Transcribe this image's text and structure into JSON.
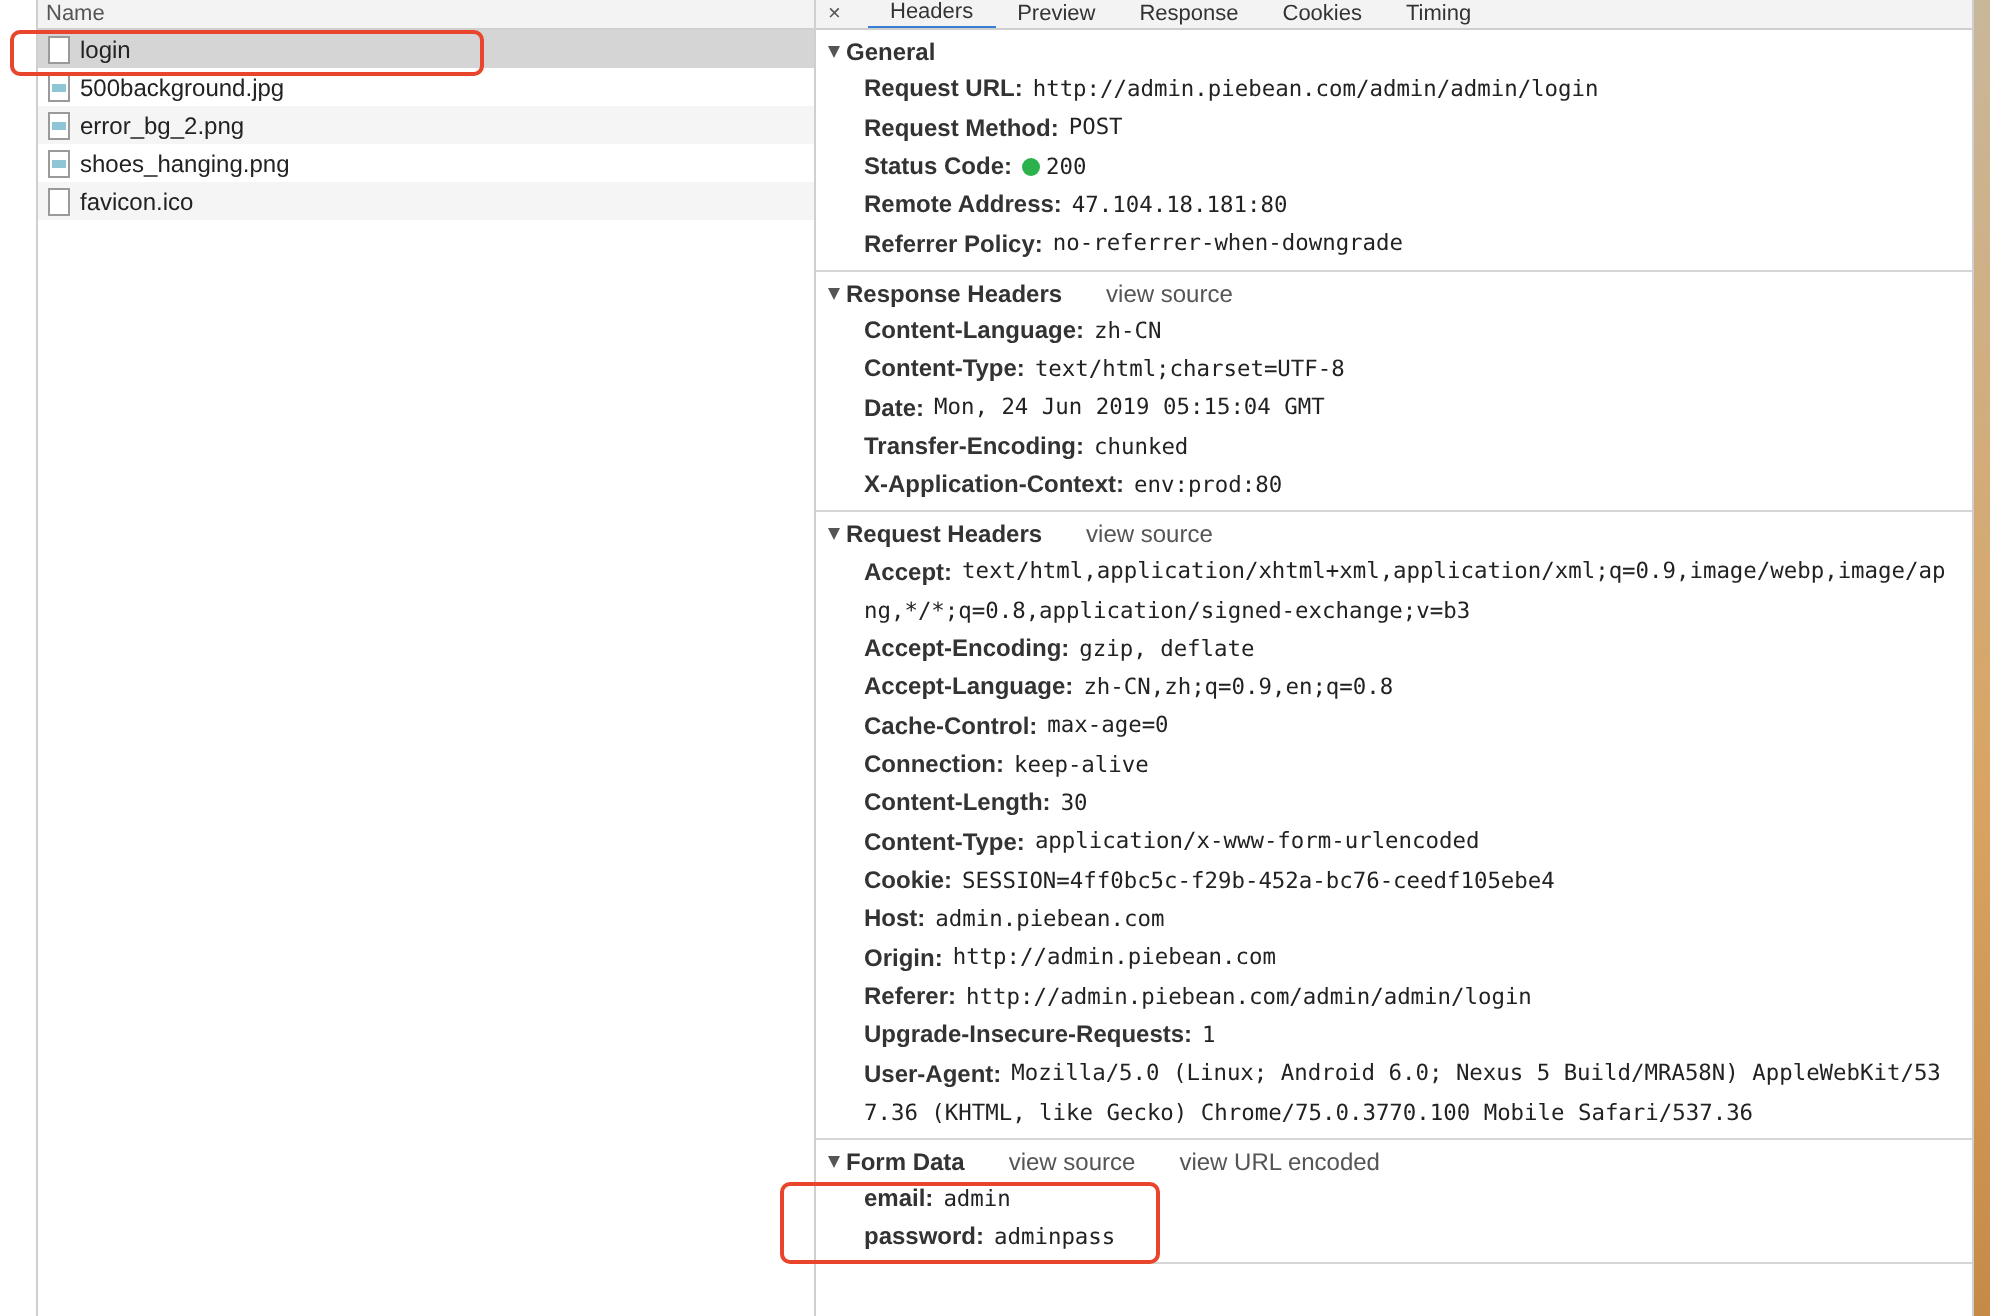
{
  "requests": {
    "column": "Name",
    "items": [
      {
        "name": "login",
        "kind": "document",
        "selected": true,
        "highlighted": true
      },
      {
        "name": "500background.jpg",
        "kind": "image",
        "selected": false,
        "highlighted": false
      },
      {
        "name": "error_bg_2.png",
        "kind": "image",
        "selected": false,
        "highlighted": false
      },
      {
        "name": "shoes_hanging.png",
        "kind": "image",
        "selected": false,
        "highlighted": false
      },
      {
        "name": "favicon.ico",
        "kind": "document",
        "selected": false,
        "highlighted": false
      }
    ]
  },
  "close": "×",
  "tabs": [
    {
      "label": "Headers",
      "selected": true
    },
    {
      "label": "Preview",
      "selected": false
    },
    {
      "label": "Response",
      "selected": false
    },
    {
      "label": "Cookies",
      "selected": false
    },
    {
      "label": "Timing",
      "selected": false
    }
  ],
  "sections": [
    {
      "title": "General",
      "expanded": true,
      "rows": [
        {
          "name": "Request URL:",
          "value": "http://admin.piebean.com/admin/admin/login"
        },
        {
          "name": "Request Method:",
          "value": "POST"
        },
        {
          "name": "Status Code:",
          "value": "200",
          "color": "#2bb24c"
        },
        {
          "name": "Remote Address:",
          "value": "47.104.18.181:80"
        },
        {
          "name": "Referrer Policy:",
          "value": "no-referrer-when-downgrade"
        }
      ]
    },
    {
      "title": "Response Headers",
      "expanded": true,
      "links": [
        "view source"
      ],
      "rows": [
        {
          "name": "Content-Language:",
          "value": "zh-CN"
        },
        {
          "name": "Content-Type:",
          "value": "text/html;charset=UTF-8"
        },
        {
          "name": "Date:",
          "value": "Mon, 24 Jun 2019 05:15:04 GMT"
        },
        {
          "name": "Transfer-Encoding:",
          "value": "chunked"
        },
        {
          "name": "X-Application-Context:",
          "value": "env:prod:80"
        }
      ]
    },
    {
      "title": "Request Headers",
      "expanded": true,
      "links": [
        "view source"
      ],
      "rows": [
        {
          "name": "Accept:",
          "value": "text/html,application/xhtml+xml,application/xml;q=0.9,image/webp,image/apng,*/*;q=0.8,application/signed-exchange;v=b3"
        },
        {
          "name": "Accept-Encoding:",
          "value": "gzip, deflate"
        },
        {
          "name": "Accept-Language:",
          "value": "zh-CN,zh;q=0.9,en;q=0.8"
        },
        {
          "name": "Cache-Control:",
          "value": "max-age=0"
        },
        {
          "name": "Connection:",
          "value": "keep-alive"
        },
        {
          "name": "Content-Length:",
          "value": "30"
        },
        {
          "name": "Content-Type:",
          "value": "application/x-www-form-urlencoded"
        },
        {
          "name": "Cookie:",
          "value": "SESSION=4ff0bc5c-f29b-452a-bc76-ceedf105ebe4"
        },
        {
          "name": "Host:",
          "value": "admin.piebean.com"
        },
        {
          "name": "Origin:",
          "value": "http://admin.piebean.com"
        },
        {
          "name": "Referer:",
          "value": "http://admin.piebean.com/admin/admin/login"
        },
        {
          "name": "Upgrade-Insecure-Requests:",
          "value": "1"
        },
        {
          "name": "User-Agent:",
          "value": "Mozilla/5.0 (Linux; Android 6.0; Nexus 5 Build/MRA58N) AppleWebKit/537.36 (KHTML, like Gecko) Chrome/75.0.3770.100 Mobile Safari/537.36"
        }
      ]
    },
    {
      "title": "Form Data",
      "expanded": true,
      "links": [
        "view source",
        "view URL encoded"
      ],
      "highlighted": true,
      "rows": [
        {
          "name": "email:",
          "value": "admin"
        },
        {
          "name": "password:",
          "value": "adminpass"
        }
      ]
    }
  ]
}
